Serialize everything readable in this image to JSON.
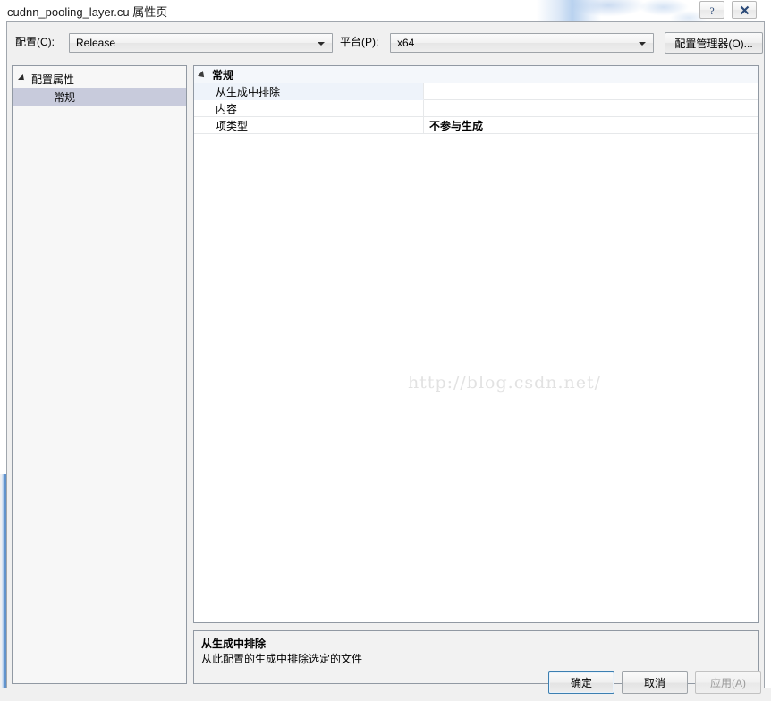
{
  "window": {
    "title": "cudnn_pooling_layer.cu 属性页",
    "help_icon": "help-question-icon",
    "close_icon": "close-x-icon"
  },
  "toolbar": {
    "config_label": "配置(C):",
    "config_value": "Release",
    "platform_label": "平台(P):",
    "platform_value": "x64",
    "config_manager_label": "配置管理器(O)..."
  },
  "tree": {
    "root_label": "配置属性",
    "child_label": "常规"
  },
  "grid": {
    "category": "常规",
    "rows": [
      {
        "name": "从生成中排除",
        "value": "",
        "bold": false,
        "selected": true
      },
      {
        "name": "内容",
        "value": "",
        "bold": false,
        "selected": false
      },
      {
        "name": "项类型",
        "value": "不参与生成",
        "bold": true,
        "selected": false
      }
    ]
  },
  "watermark": {
    "text": "http://blog.csdn.net/"
  },
  "description": {
    "title": "从生成中排除",
    "body": "从此配置的生成中排除选定的文件"
  },
  "footer": {
    "ok_label": "确定",
    "cancel_label": "取消",
    "apply_label": "应用(A)"
  },
  "colors": {
    "dialog_bg": "#f0f0f0",
    "panel_border": "#9199a3",
    "tree_selection": "#c8cbdc",
    "grid_category_bg": "#f4f7fb",
    "grid_row_selected_bg": "#eef3fa",
    "default_button_border": "#3c7fb1",
    "disabled_text": "#9a9a9a"
  }
}
